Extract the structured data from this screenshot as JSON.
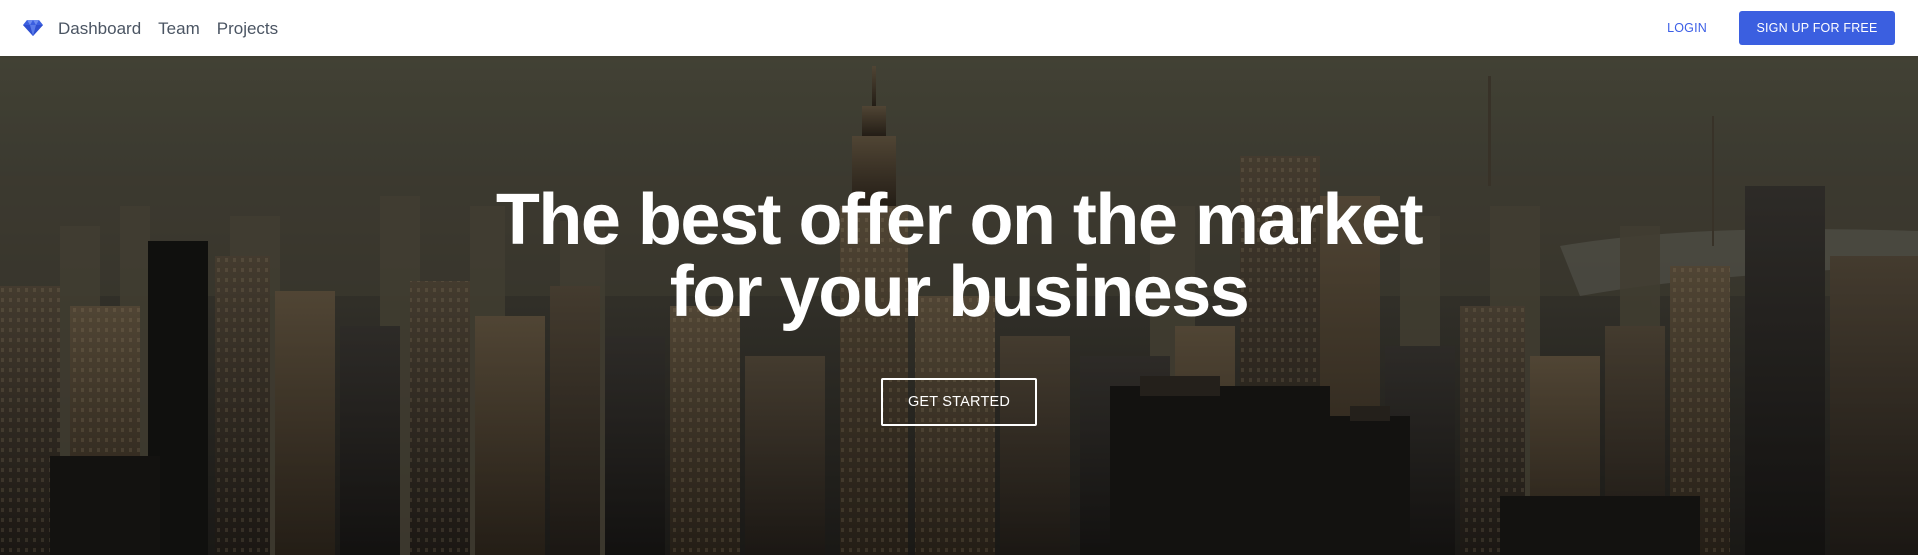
{
  "navbar": {
    "logo_icon": "diamond-icon",
    "links": [
      {
        "label": "Dashboard"
      },
      {
        "label": "Team"
      },
      {
        "label": "Projects"
      }
    ],
    "login_label": "LOGIN",
    "signup_label": "SIGN UP FOR FREE"
  },
  "hero": {
    "title_line1": "The best offer on the market",
    "title_line2": "for your business",
    "cta_label": "GET STARTED",
    "background": "city-skyline-photo"
  },
  "colors": {
    "accent": "#3b5fe0",
    "nav_text": "#4b5563",
    "hero_text": "#ffffff"
  }
}
